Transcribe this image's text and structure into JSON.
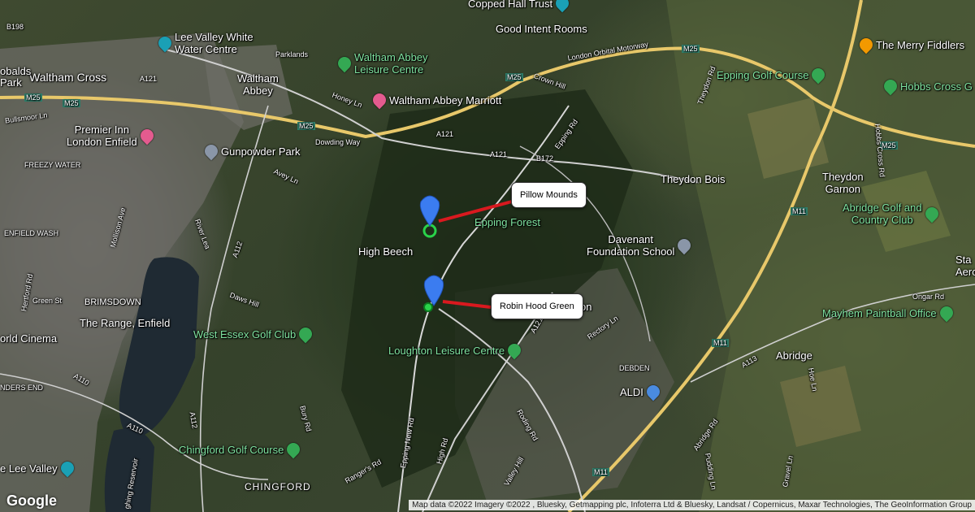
{
  "map": {
    "place_labels": {
      "copped_hall_trust": "Copped Hall Trust",
      "good_intent_rooms": "Good Intent Rooms",
      "lee_valley_white_water": "Lee Valley White\nWater Centre",
      "waltham_abbey_leisure": "Waltham Abbey\nLeisure Centre",
      "waltham_cross": "Waltham Cross",
      "waltham_abbey": "Waltham\nAbbey",
      "waltham_abbey_marriott": "Waltham Abbey Marriott",
      "premier_inn": "Premier Inn\nLondon Enfield",
      "gunpowder_park": "Gunpowder Park",
      "freezy_water": "FREEZY WATER",
      "enfield_wash": "ENFIELD WASH",
      "high_beech": "High Beech",
      "epping_forest": "Epping Forest",
      "davenant": "Davenant\nFoundation School",
      "theydon_bois": "Theydon Bois",
      "theydon_garnon": "Theydon\nGarnon",
      "epping_golf": "Epping Golf Course",
      "hobbs_cross": "Hobbs Cross G",
      "merry_fiddlers": "The Merry Fiddlers",
      "abridge_golf": "Abridge Golf and\nCountry Club",
      "mayhem": "Mayhem Paintball Office",
      "abridge": "Abridge",
      "brimsdown": "BRIMSDOWN",
      "the_range": "The Range, Enfield",
      "world_cinema": "orld Cinema",
      "west_essex_golf": "West Essex Golf Club",
      "loughton_leisure": "Loughton Leisure Centre",
      "aldi": "ALDI",
      "chingford_golf": "Chingford Golf Course",
      "chingford": "CHINGFORD",
      "lee_valley": "e Lee Valley",
      "nders_end": "NDERS END",
      "debden": "DEBDEN",
      "theobalds_park": "obalds\nPark",
      "loughton_partial": "on",
      "sta_aero": "Sta\nAero"
    },
    "road_labels": {
      "m25_a": "M25",
      "m25_b": "M25",
      "m25_c": "M25",
      "m25_d": "M25",
      "m25_e": "M25",
      "m11_a": "M11",
      "m11_b": "M11",
      "m11_c": "M11",
      "a121_a": "A121",
      "a121_b": "A121",
      "a121_c": "A121",
      "b198": "B198",
      "parklands": "Parklands",
      "honey_ln": "Honey Ln",
      "dowding_way": "Dowding Way",
      "avey_ln": "Avey Ln",
      "crown_hill": "Crown Hill",
      "orbital_motorway": "London Orbital Motorway",
      "epping_rd": "Epping Rd",
      "b172": "B172",
      "theydon_rd": "Theydon Rd",
      "hobbs_cross_rd": "Hobbs Cross Rd",
      "a112_a": "A112",
      "a112_b": "A112",
      "river_lea": "River Lea",
      "daws_hill": "Daws Hill",
      "mollison_ave": "Mollison Ave",
      "hertford_rd": "Hertford Rd",
      "green_st": "Green St",
      "bullsmoor_ln": "Bullsmoor Ln",
      "a110_a": "A110",
      "a110_b": "A110",
      "bury_rd": "Bury Rd",
      "rangers_rd": "Ranger's Rd",
      "epping_new_rd": "Epping New Rd",
      "high_rd": "High Rd",
      "rectory_ln": "Rectory Ln",
      "ongar_rd": "Ongar Rd",
      "a113": "A113",
      "abridge_rd": "Abridge Rd",
      "hoe_ln": "Hoe Ln",
      "roding_rd": "Roding Rd",
      "valley_hill": "Valley Hill",
      "pudding_ln": "Pudding Ln",
      "gravel_ln": "Gravel Ln",
      "chingford_reservoir": "ghing Reservoir"
    },
    "markers": [
      {
        "id": "pillow-mounds",
        "label": "Pillow Mounds"
      },
      {
        "id": "robin-hood-green",
        "label": "Robin Hood Green"
      }
    ],
    "branding": "Google",
    "attribution": "Map data ©2022 Imagery ©2022 , Bluesky, Getmapping plc, Infoterra Ltd & Bluesky, Landsat / Copernicus, Maxar Technologies, The GeoInformation Group"
  }
}
